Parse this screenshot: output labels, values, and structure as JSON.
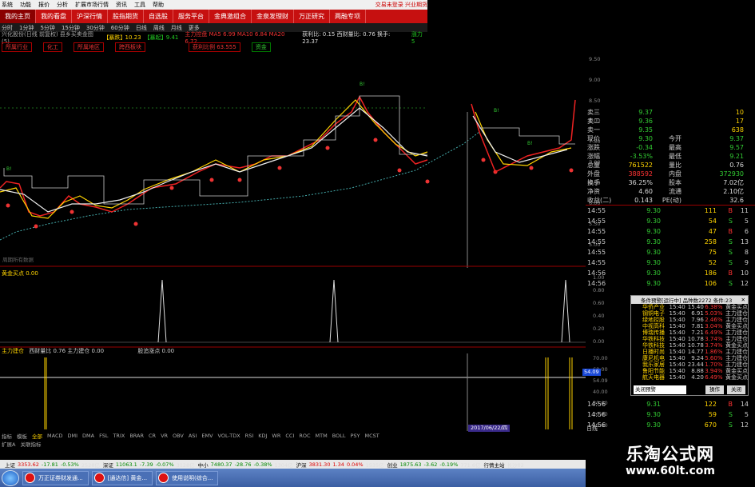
{
  "menubar": {
    "items": [
      "系统",
      "功能",
      "报价",
      "分析",
      "扩展市场行情",
      "资讯",
      "工具",
      "帮助"
    ],
    "right": [
      "交易未登录",
      "兴业期货"
    ]
  },
  "navbar": {
    "items": [
      "我的主页",
      "我的看盘",
      "沪深行情",
      "股指期货",
      "自选股",
      "服务平台",
      "金典激组合",
      "金泉发理财",
      "万正研究",
      "两融专项"
    ],
    "active_index": 0
  },
  "periodbar": {
    "items": [
      "分时",
      "1分钟",
      "5分钟",
      "15分钟",
      "30分钟",
      "60分钟",
      "日线",
      "周线",
      "月线",
      "更多"
    ]
  },
  "infobar": {
    "title": "兴化股份(日线 前复权) 县乡买卖金图(5)",
    "value1_label": "【暴跌】",
    "value1": "10.23",
    "value2_label": "【暴起】",
    "value2": "9.41",
    "ma_text": "主力控盘 MA5 6.99 MA10 6.84 MA20 6.72",
    "ratio_text": "获利比: 0.15 西财量比: 0.76 换手: 23.37",
    "right_text": "涨力 5"
  },
  "tags": {
    "left": [
      "所属行业",
      "化工",
      "所属地区",
      "跨西板块"
    ],
    "right": [
      "获利比例 63.555",
      "资金"
    ]
  },
  "main_chart": {
    "labels": [
      "买点",
      "B!"
    ],
    "price_axis": [
      "9.50",
      "9.00",
      "8.50",
      "8.00",
      "7.50",
      "7.00",
      "6.50",
      "6.00",
      "5.50",
      "5.00"
    ],
    "hint": "周期所有数据"
  },
  "panel2": {
    "label_main": "黄金买点",
    "label_sub": "黄金买点 0.00",
    "axis": [
      "1.00",
      "0.80",
      "0.60",
      "0.40",
      "0.20",
      "0.00"
    ]
  },
  "panel3": {
    "label_main": "主力建仓",
    "label_sub": "西财量比 0.76 主力建仓 0.00",
    "label_right": "股追涨点 0.00",
    "axis": [
      "70.00",
      "60.00",
      "54.09",
      "40.00",
      "30.00",
      "20.00",
      "10.00"
    ],
    "highlight_value": "54.09"
  },
  "quote": {
    "rows": [
      {
        "k": "卖三",
        "v1": "9.37",
        "v1c": "g",
        "k2": "",
        "v2": "10",
        "v2c": "y"
      },
      {
        "k": "卖二",
        "v1": "9.36",
        "v1c": "g",
        "k2": "",
        "v2": "17",
        "v2c": "y"
      },
      {
        "k": "卖一",
        "v1": "9.35",
        "v1c": "g",
        "k2": "",
        "v2": "638",
        "v2c": "y"
      },
      {
        "k": "现价",
        "v1": "9.30",
        "v1c": "g",
        "k2": "今开",
        "v2": "9.37",
        "v2c": "g"
      },
      {
        "k": "涨跌",
        "v1": "-0.34",
        "v1c": "g",
        "k2": "最高",
        "v2": "9.57",
        "v2c": "g"
      },
      {
        "k": "涨幅",
        "v1": "-3.53%",
        "v1c": "g",
        "k2": "最低",
        "v2": "9.21",
        "v2c": "g"
      },
      {
        "k": "总量",
        "v1": "761522",
        "v1c": "y",
        "k2": "量比",
        "v2": "0.76",
        "v2c": "w"
      },
      {
        "k": "外盘",
        "v1": "388592",
        "v1c": "r",
        "k2": "内盘",
        "v2": "372930",
        "v2c": "g"
      },
      {
        "k": "换手",
        "v1": "36.25%",
        "v1c": "w",
        "k2": "股本",
        "v2": "7.02亿",
        "v2c": "w"
      },
      {
        "k": "净资",
        "v1": "4.60",
        "v1c": "w",
        "k2": "流通",
        "v2": "2.10亿",
        "v2c": "w"
      },
      {
        "k": "收益(二)",
        "v1": "0.143",
        "v1c": "w",
        "k2": "PE(动)",
        "v2": "32.6",
        "v2c": "w"
      }
    ],
    "ticks": [
      {
        "t": "14:55",
        "p": "9.30",
        "vol": "111",
        "bs": "B",
        "bsc": "r",
        "n": "11"
      },
      {
        "t": "14:55",
        "p": "9.30",
        "vol": "54",
        "bs": "S",
        "bsc": "g",
        "n": "5"
      },
      {
        "t": "14:55",
        "p": "9.30",
        "vol": "47",
        "bs": "B",
        "bsc": "r",
        "n": "6"
      },
      {
        "t": "14:55",
        "p": "9.30",
        "vol": "258",
        "bs": "S",
        "bsc": "g",
        "n": "13"
      },
      {
        "t": "14:55",
        "p": "9.30",
        "vol": "75",
        "bs": "S",
        "bsc": "g",
        "n": "8"
      },
      {
        "t": "14:55",
        "p": "9.30",
        "vol": "52",
        "bs": "S",
        "bsc": "g",
        "n": "9"
      },
      {
        "t": "14:56",
        "p": "9.30",
        "vol": "186",
        "bs": "B",
        "bsc": "r",
        "n": "10"
      },
      {
        "t": "14:56",
        "p": "9.30",
        "vol": "106",
        "bs": "S",
        "bsc": "g",
        "n": "12"
      }
    ],
    "ticks_bottom": [
      {
        "t": "14:56",
        "p": "9.31",
        "vol": "122",
        "bs": "B",
        "bsc": "r",
        "n": "14"
      },
      {
        "t": "14:56",
        "p": "9.30",
        "vol": "59",
        "bs": "S",
        "bsc": "g",
        "n": "5"
      },
      {
        "t": "14:56",
        "p": "9.30",
        "vol": "670",
        "bs": "S",
        "bsc": "g",
        "n": "12"
      },
      {
        "t": "15:00",
        "p": "9.30",
        "vol": "12955",
        "bs": "",
        "bsc": "w",
        "n": "91"
      }
    ]
  },
  "popup": {
    "title": "条件预警[运行中] 品种数2272 条件:23",
    "rows": [
      {
        "nm": "华侨产业",
        "tm": "15:40",
        "pr": "15.40",
        "pc": "6.38%",
        "sg": "黄金买点"
      },
      {
        "nm": "钢铜电子",
        "tm": "15:40",
        "pr": "6.91",
        "pc": "5.03%",
        "sg": "主力建仓"
      },
      {
        "nm": "绿地控股",
        "tm": "15:40",
        "pr": "7.96",
        "pc": "2.46%",
        "sg": "主力建仓"
      },
      {
        "nm": "中视高科",
        "tm": "15:40",
        "pr": "7.81",
        "pc": "3.04%",
        "sg": "黄金买点"
      },
      {
        "nm": "博瑞传播",
        "tm": "15:40",
        "pr": "7.21",
        "pc": "6.49%",
        "sg": "主力建仓"
      },
      {
        "nm": "华铁科技",
        "tm": "15:40",
        "pr": "10.78",
        "pc": "3.74%",
        "sg": "主力建仓"
      },
      {
        "nm": "华铁科技",
        "tm": "15:40",
        "pr": "10.78",
        "pc": "3.74%",
        "sg": "黄金买点"
      },
      {
        "nm": "日播时尚",
        "tm": "15:40",
        "pr": "14.77",
        "pc": "1.86%",
        "sg": "主力建仓"
      },
      {
        "nm": "康尼机电",
        "tm": "15:40",
        "pr": "9.24",
        "pc": "5.60%",
        "sg": "主力建仓"
      },
      {
        "nm": "我乐家居",
        "tm": "15:40",
        "pr": "23.44",
        "pc": "1.70%",
        "sg": "主力建仓"
      },
      {
        "nm": "鲁阳节能",
        "tm": "15:40",
        "pr": "8.88",
        "pc": "3.94%",
        "sg": "黄金买点"
      },
      {
        "nm": "航天电器",
        "tm": "15:40",
        "pr": "4.20",
        "pc": "6.49%",
        "sg": "黄金买点"
      }
    ],
    "select": "关闭预警",
    "btn_op": "操作",
    "btn_close": "关闭"
  },
  "bottom": {
    "tabs": [
      "指标",
      "模板",
      "全部",
      "MACD",
      "DMI",
      "DMA",
      "FSL",
      "TRIX",
      "BRAR",
      "CR",
      "VR",
      "OBV",
      "ASI",
      "EMV",
      "VOL-TDX",
      "RSI",
      "KDJ",
      "WR",
      "CCI",
      "ROC",
      "MTM",
      "BOLL",
      "PSY",
      "MCST"
    ],
    "tabs2": [
      "扩展A",
      "关联指标"
    ],
    "date_label": "2017/06/22/四",
    "right_label": "日线"
  },
  "indexbar": {
    "items": [
      {
        "n": "上证",
        "v": "3353.62",
        "c": "r"
      },
      {
        "n": "",
        "v": "-17.81",
        "c": "g"
      },
      {
        "n": "",
        "v": "-0.53%",
        "c": "g"
      },
      {
        "n": "",
        "v": "2528亿",
        "c": "w"
      },
      {
        "n": "深证",
        "v": "11063.1",
        "c": "g"
      },
      {
        "n": "",
        "v": "-7.39",
        "c": "g"
      },
      {
        "n": "",
        "v": "-0.07%",
        "c": "g"
      },
      {
        "n": "",
        "v": "3128亿",
        "c": "w"
      },
      {
        "n": "中小",
        "v": "7480.37",
        "c": "g"
      },
      {
        "n": "",
        "v": "-28.76",
        "c": "g"
      },
      {
        "n": "",
        "v": "-0.38%",
        "c": "g"
      },
      {
        "n": "",
        "v": "1304亿",
        "c": "w"
      },
      {
        "n": "沪深",
        "v": "3831.30",
        "c": "r"
      },
      {
        "n": "",
        "v": "1.34",
        "c": "r"
      },
      {
        "n": "",
        "v": "0.04%",
        "c": "r"
      },
      {
        "n": "",
        "v": "1535亿",
        "c": "w"
      },
      {
        "n": "创业",
        "v": "1875.63",
        "c": "g"
      },
      {
        "n": "",
        "v": "-3.62",
        "c": "g"
      },
      {
        "n": "",
        "v": "-0.19%",
        "c": "g"
      },
      {
        "n": "",
        "v": "771.6亿",
        "c": "w"
      },
      {
        "n": "行情主站",
        "v": "长沙02",
        "c": "w"
      }
    ]
  },
  "taskbar": {
    "tasks": [
      "万正证券财发通...",
      "[通达信] 黄金...",
      "使用说明(综合..."
    ]
  },
  "watermark": {
    "title": "乐淘公式网",
    "url": "www.60lt.com"
  }
}
